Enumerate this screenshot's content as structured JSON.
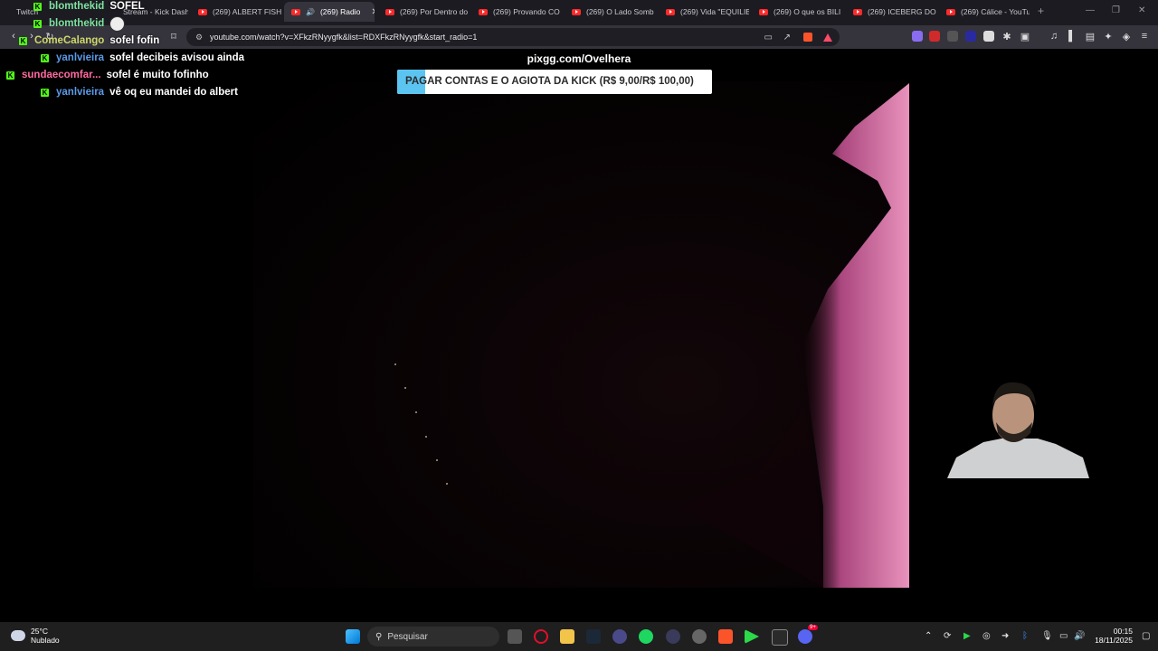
{
  "browser": {
    "tabs": [
      {
        "label": "Stream - Kick Dash",
        "type": "kick"
      },
      {
        "label": "(269) ALBERT FISH",
        "type": "yt"
      },
      {
        "label": "(269) Radio",
        "type": "yt",
        "active": true
      },
      {
        "label": "(269) Por Dentro do",
        "type": "yt"
      },
      {
        "label": "(269) Provando CO",
        "type": "yt"
      },
      {
        "label": "(269) O Lado Somb",
        "type": "yt"
      },
      {
        "label": "(269) Vida \"EQUILIB",
        "type": "yt"
      },
      {
        "label": "(269) O que os BILI",
        "type": "yt"
      },
      {
        "label": "(269) ICEBERG DO",
        "type": "yt"
      },
      {
        "label": "(269) Cálice - YouTu",
        "type": "yt"
      }
    ],
    "first_tab_label": "Twitch",
    "url": "youtube.com/watch?v=XFkzRNyygfk&list=RDXFkzRNyygfk&start_radio=1"
  },
  "overlay": {
    "pix_text": "pixgg.com/Ovelhera",
    "banner_text": "PAGAR CONTAS E O AGIOTA DA KICK (R$ 9,00/R$ 100,00)",
    "goal_progress_fraction": 0.09,
    "chat": [
      {
        "user": "blomthekid",
        "message": "SOFEL",
        "color": "#7fe3a0"
      },
      {
        "user": "blomthekid",
        "message": "",
        "color": "#7fe3a0",
        "emote": true
      },
      {
        "user": "ComeCalango",
        "message": "sofel fofin",
        "color": "#cfd86a"
      },
      {
        "user": "yanlvieira",
        "message": "sofel decibeis avisou ainda",
        "color": "#5b9ae8"
      },
      {
        "user": "sundaecomfar...",
        "message": "sofel é muito fofinho",
        "color": "#ff6aa0"
      },
      {
        "user": "yanlvieira",
        "message": "vê oq eu mandei do albert",
        "color": "#5b9ae8"
      }
    ]
  },
  "taskbar": {
    "weather_temp": "25°C",
    "weather_desc": "Nublado",
    "search_placeholder": "Pesquisar",
    "time": "00:15",
    "date": "18/11/2025",
    "discord_badge": "9+"
  }
}
